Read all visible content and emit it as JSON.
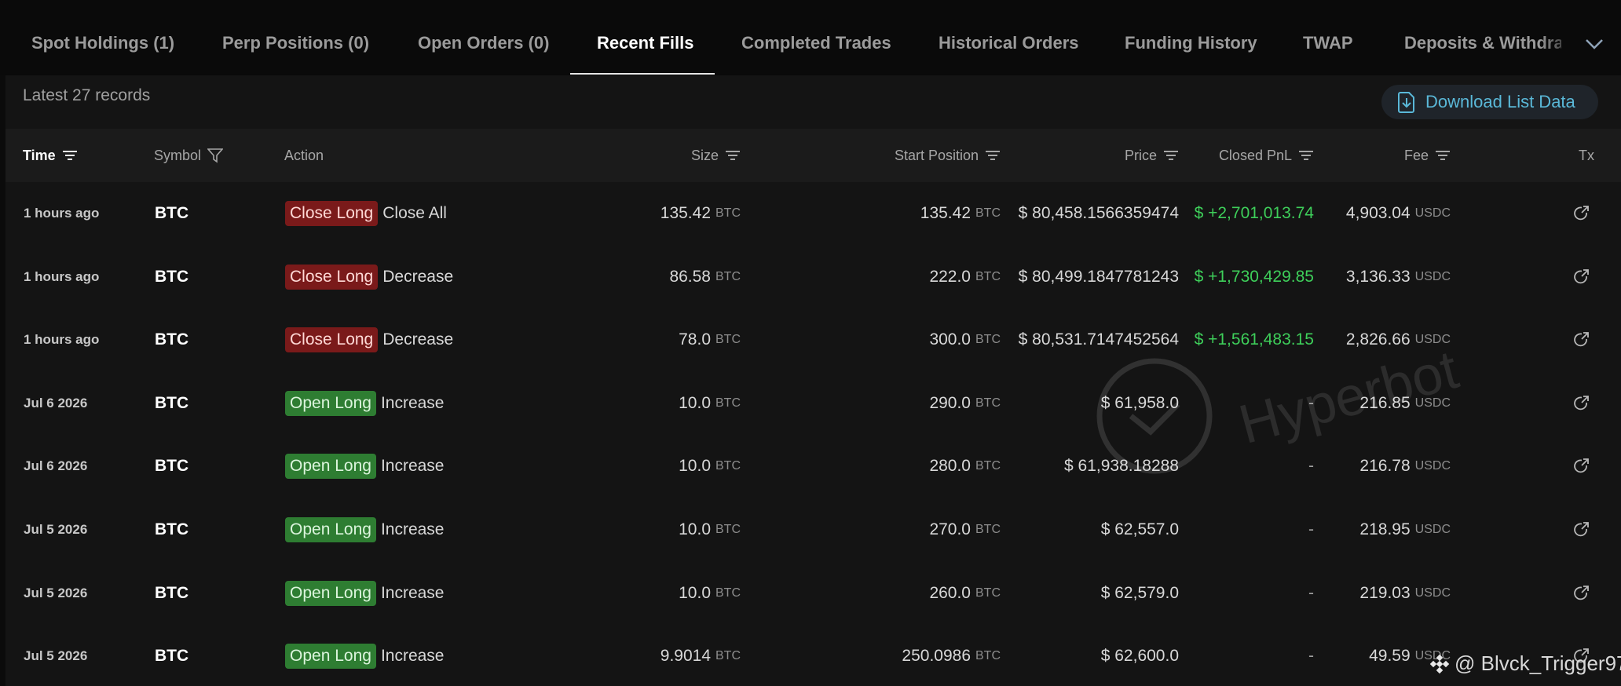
{
  "tabs": [
    {
      "label": "Spot Holdings (1)"
    },
    {
      "label": "Perp Positions (0)"
    },
    {
      "label": "Open Orders (0)"
    },
    {
      "label": "Recent Fills"
    },
    {
      "label": "Completed Trades"
    },
    {
      "label": "Historical Orders"
    },
    {
      "label": "Funding History"
    },
    {
      "label": "TWAP"
    },
    {
      "label": "Deposits & Withdraw"
    }
  ],
  "active_tab": "Recent Fills",
  "records_label": "Latest 27 records",
  "download_label": "Download List Data",
  "headers": {
    "time": "Time",
    "symbol": "Symbol",
    "action": "Action",
    "size": "Size",
    "start_position": "Start Position",
    "price": "Price",
    "closed_pnl": "Closed PnL",
    "fee": "Fee",
    "tx": "Tx"
  },
  "rows": [
    {
      "time": "1 hours ago",
      "symbol": "BTC",
      "badge": "Close Long",
      "badge_type": "close",
      "action_detail": "Close All",
      "size": "135.42",
      "size_unit": "BTC",
      "start": "135.42",
      "start_unit": "BTC",
      "price": "$ 80,458.1566359474",
      "pnl": "$ +2,701,013.74",
      "pnl_type": "pos",
      "fee": "4,903.04",
      "fee_unit": "USDC"
    },
    {
      "time": "1 hours ago",
      "symbol": "BTC",
      "badge": "Close Long",
      "badge_type": "close",
      "action_detail": "Decrease",
      "size": "86.58",
      "size_unit": "BTC",
      "start": "222.0",
      "start_unit": "BTC",
      "price": "$ 80,499.1847781243",
      "pnl": "$ +1,730,429.85",
      "pnl_type": "pos",
      "fee": "3,136.33",
      "fee_unit": "USDC"
    },
    {
      "time": "1 hours ago",
      "symbol": "BTC",
      "badge": "Close Long",
      "badge_type": "close",
      "action_detail": "Decrease",
      "size": "78.0",
      "size_unit": "BTC",
      "start": "300.0",
      "start_unit": "BTC",
      "price": "$ 80,531.7147452564",
      "pnl": "$ +1,561,483.15",
      "pnl_type": "pos",
      "fee": "2,826.66",
      "fee_unit": "USDC"
    },
    {
      "time": "Jul 6 2026",
      "symbol": "BTC",
      "badge": "Open Long",
      "badge_type": "open",
      "action_detail": "Increase",
      "size": "10.0",
      "size_unit": "BTC",
      "start": "290.0",
      "start_unit": "BTC",
      "price": "$ 61,958.0",
      "pnl": "-",
      "pnl_type": "dash",
      "fee": "216.85",
      "fee_unit": "USDC"
    },
    {
      "time": "Jul 6 2026",
      "symbol": "BTC",
      "badge": "Open Long",
      "badge_type": "open",
      "action_detail": "Increase",
      "size": "10.0",
      "size_unit": "BTC",
      "start": "280.0",
      "start_unit": "BTC",
      "price": "$ 61,938.18288",
      "pnl": "-",
      "pnl_type": "dash",
      "fee": "216.78",
      "fee_unit": "USDC"
    },
    {
      "time": "Jul 5 2026",
      "symbol": "BTC",
      "badge": "Open Long",
      "badge_type": "open",
      "action_detail": "Increase",
      "size": "10.0",
      "size_unit": "BTC",
      "start": "270.0",
      "start_unit": "BTC",
      "price": "$ 62,557.0",
      "pnl": "-",
      "pnl_type": "dash",
      "fee": "218.95",
      "fee_unit": "USDC"
    },
    {
      "time": "Jul 5 2026",
      "symbol": "BTC",
      "badge": "Open Long",
      "badge_type": "open",
      "action_detail": "Increase",
      "size": "10.0",
      "size_unit": "BTC",
      "start": "260.0",
      "start_unit": "BTC",
      "price": "$ 62,579.0",
      "pnl": "-",
      "pnl_type": "dash",
      "fee": "219.03",
      "fee_unit": "USDC"
    },
    {
      "time": "Jul 5 2026",
      "symbol": "BTC",
      "badge": "Open Long",
      "badge_type": "open",
      "action_detail": "Increase",
      "size": "9.9014",
      "size_unit": "BTC",
      "start": "250.0986",
      "start_unit": "BTC",
      "price": "$ 62,600.0",
      "pnl": "-",
      "pnl_type": "dash",
      "fee": "49.59",
      "fee_unit": "USDC"
    }
  ],
  "watermark": "Hyperbot",
  "credit": "@ Blvck_Trigger97",
  "colors": {
    "accent": "#5ab8d8",
    "positive": "#3ecf5a",
    "close_badge": "#7a1a1a",
    "open_badge": "#2e7d32"
  }
}
